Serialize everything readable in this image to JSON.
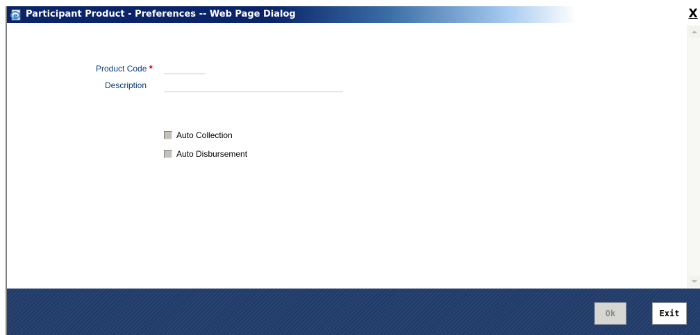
{
  "window": {
    "title": "Participant Product - Preferences -- Web Page Dialog",
    "close_glyph": "X"
  },
  "form": {
    "product_code_label": "Product Code",
    "required_marker": "*",
    "product_code_value": "",
    "description_label": "Description",
    "description_value": "",
    "checkboxes": [
      {
        "label": "Auto Collection",
        "checked": false,
        "disabled": true
      },
      {
        "label": "Auto Disbursement",
        "checked": false,
        "disabled": true
      }
    ]
  },
  "footer": {
    "ok_label": "Ok",
    "exit_label": "Exit"
  },
  "colors": {
    "titlebar_start": "#0a246a",
    "label_blue": "#0a3a7a",
    "required_red": "#d40000",
    "footer_bg": "#223c6a"
  }
}
